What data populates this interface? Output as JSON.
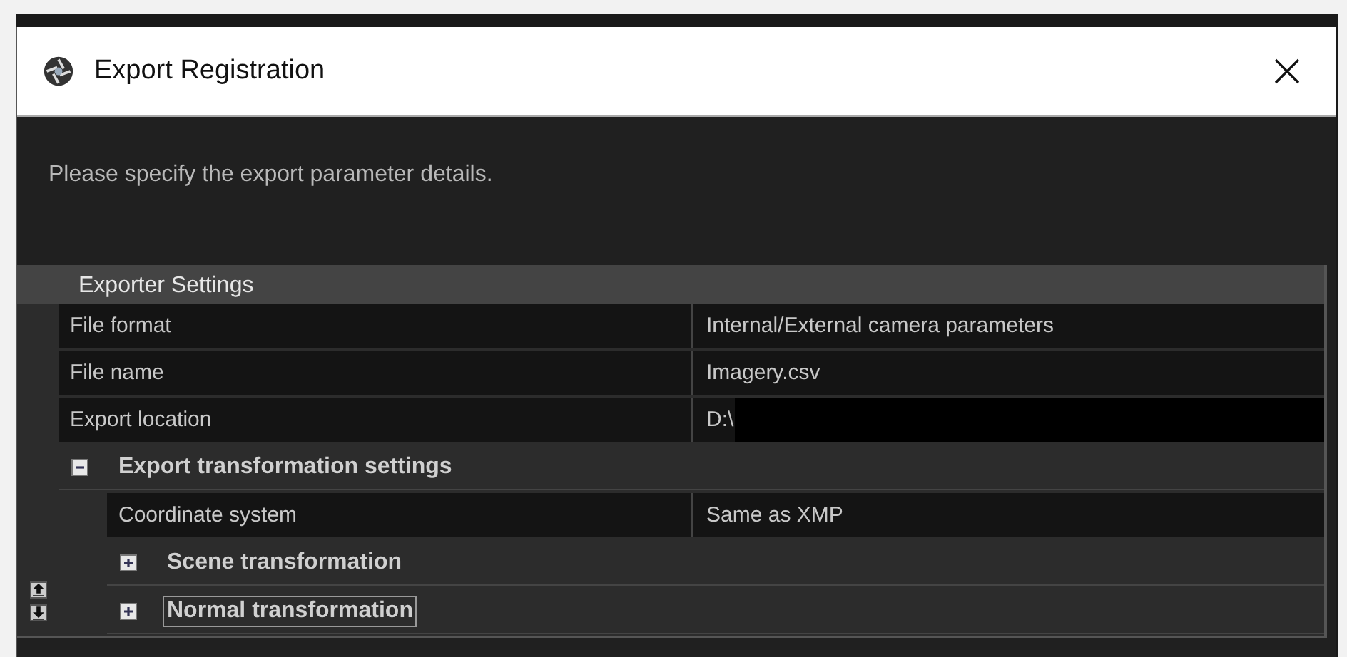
{
  "window": {
    "title": "Export Registration"
  },
  "message": "Please specify the export parameter details.",
  "settings": {
    "title": "Exporter Settings",
    "items": [
      {
        "kind": "property",
        "label": "File format",
        "value": "Internal/External camera parameters",
        "redacted": false
      },
      {
        "kind": "property",
        "label": "File name",
        "value": "Imagery.csv",
        "redacted": false
      },
      {
        "kind": "property",
        "label": "Export location",
        "value": "D:\\",
        "redacted": true
      },
      {
        "kind": "group",
        "label": "Export transformation settings",
        "expanded": true,
        "selected": false,
        "children": [
          {
            "kind": "property",
            "label": "Coordinate system",
            "value": "Same as XMP",
            "redacted": false
          },
          {
            "kind": "group",
            "label": "Scene transformation",
            "expanded": false,
            "selected": false
          },
          {
            "kind": "group",
            "label": "Normal transformation",
            "expanded": false,
            "selected": true
          }
        ]
      }
    ]
  }
}
